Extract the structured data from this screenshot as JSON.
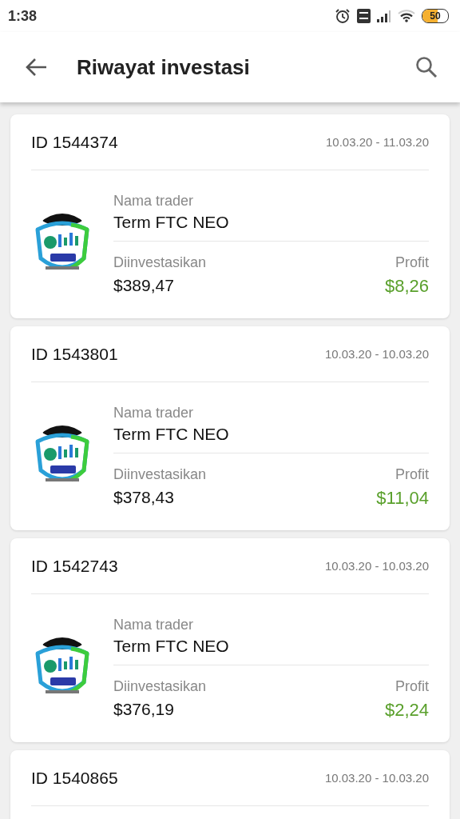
{
  "status_bar": {
    "time": "1:38",
    "battery": "50"
  },
  "app_bar": {
    "title": "Riwayat investasi"
  },
  "investments": [
    {
      "id": "ID 1544374",
      "period": "10.03.20 - 11.03.20",
      "trader_label": "Nama trader",
      "trader": "Term FTC NEO",
      "invested_label": "Diinvestasikan",
      "invested": "$389,47",
      "profit_label": "Profit",
      "profit": "$8,26"
    },
    {
      "id": "ID 1543801",
      "period": "10.03.20 - 10.03.20",
      "trader_label": "Nama trader",
      "trader": "Term FTC NEO",
      "invested_label": "Diinvestasikan",
      "invested": "$378,43",
      "profit_label": "Profit",
      "profit": "$11,04"
    },
    {
      "id": "ID 1542743",
      "period": "10.03.20 - 10.03.20",
      "trader_label": "Nama trader",
      "trader": "Term FTC NEO",
      "invested_label": "Diinvestasikan",
      "invested": "$376,19",
      "profit_label": "Profit",
      "profit": "$2,24"
    },
    {
      "id": "ID 1540865",
      "period": "10.03.20 - 10.03.20"
    }
  ]
}
